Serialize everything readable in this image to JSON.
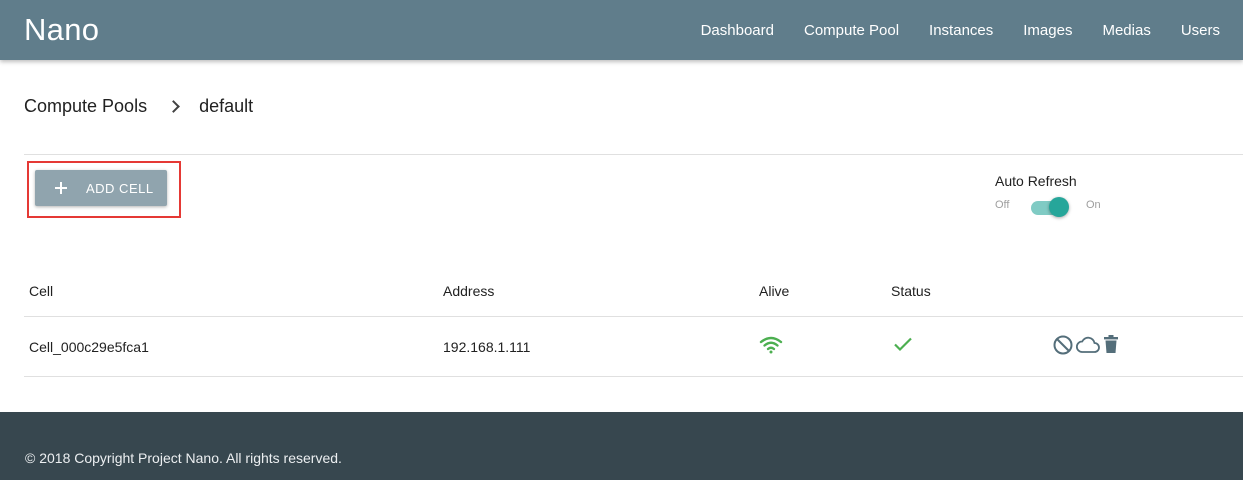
{
  "header": {
    "brand": "Nano",
    "nav": [
      "Dashboard",
      "Compute Pool",
      "Instances",
      "Images",
      "Medias",
      "Users"
    ]
  },
  "breadcrumb": {
    "parent": "Compute Pools",
    "current": "default"
  },
  "toolbar": {
    "add_cell_label": "ADD CELL",
    "plus_icon": "plus-icon"
  },
  "auto_refresh": {
    "label": "Auto Refresh",
    "off_label": "Off",
    "on_label": "On",
    "enabled": true,
    "accent_color": "#26a69a"
  },
  "table": {
    "columns": [
      "Cell",
      "Address",
      "Alive",
      "Status"
    ],
    "rows": [
      {
        "cell": "Cell_000c29e5fca1",
        "address": "192.168.1.111",
        "alive_icon": "wifi-icon",
        "status_icon": "check-icon",
        "actions": [
          "disable-icon",
          "cloud-icon",
          "trash-icon"
        ]
      }
    ]
  },
  "colors": {
    "appbar": "#607d8b",
    "button": "#90a4ae",
    "highlight": "#e53935",
    "alive": "#4caf50",
    "footer": "#37474f"
  },
  "footer": {
    "copyright": "© 2018 Copyright Project Nano. All rights reserved."
  }
}
